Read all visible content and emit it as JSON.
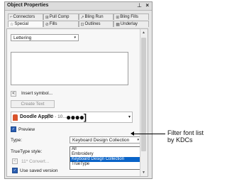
{
  "panel": {
    "title": "Object Properties",
    "pin_icon": "pin-icon",
    "close_symbol": "×"
  },
  "tabs": {
    "row1": [
      {
        "label": "Connectors",
        "icon": "connector-icon"
      },
      {
        "label": "Pull Comp",
        "icon": "pull-comp-icon"
      },
      {
        "label": "Bling Run",
        "icon": "bling-run-icon"
      },
      {
        "label": "Bling Fills",
        "icon": "bling-fills-icon"
      }
    ],
    "row2": [
      {
        "label": "Special",
        "icon": "star-icon",
        "active": true
      },
      {
        "label": "Fills",
        "icon": "fills-icon"
      },
      {
        "label": "Outlines",
        "icon": "outlines-icon"
      },
      {
        "label": "Underlay",
        "icon": "underlay-icon"
      }
    ]
  },
  "object_type": {
    "value": "Lettering"
  },
  "insert": {
    "chevron": "<",
    "label": "Insert symbol..."
  },
  "create_text": {
    "label": "Create Text"
  },
  "font": {
    "name": "Doodle Applic",
    "size": "(70 - 10...",
    "sample": "●●●●]"
  },
  "preview": {
    "label": "Preview",
    "checked": true
  },
  "type": {
    "label": "Type:",
    "value": "Keyboard Design Collection"
  },
  "truetype": {
    "label": "TrueType style:"
  },
  "dropdown": {
    "options": [
      "All",
      "Embroidery",
      "Keyboard Design Collection",
      "TrueType"
    ],
    "selected_index": 2
  },
  "disabled_row": {
    "chevron": "<",
    "label": "11* Convert..."
  },
  "saved_version": {
    "label": "Use saved version",
    "checked": true
  },
  "callout": {
    "line1": "Filter font list",
    "line2": "by KDCs"
  },
  "colors": {
    "accent": "#2a5db0",
    "selection": "#0a64c8",
    "font_icon": "#d9532b"
  }
}
